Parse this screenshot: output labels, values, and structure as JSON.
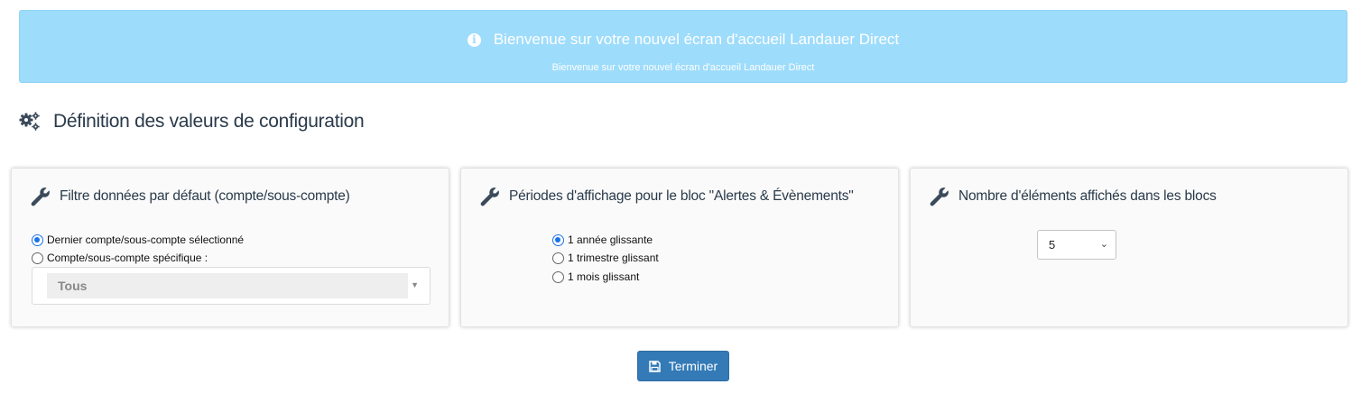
{
  "banner": {
    "title": "Bienvenue sur votre nouvel écran d'accueil Landauer Direct",
    "subtitle": "Bienvenue sur votre nouvel écran d'accueil Landauer Direct",
    "icon": "info-icon"
  },
  "section": {
    "title": "Définition des valeurs de configuration",
    "icon": "gears-icon"
  },
  "cards": {
    "filter": {
      "title": "Filtre données par défaut (compte/sous-compte)",
      "icon": "wrench-icon",
      "options": [
        {
          "label": "Dernier compte/sous-compte sélectionné",
          "checked": true
        },
        {
          "label": "Compte/sous-compte spécifique :",
          "checked": false
        }
      ],
      "select_value": "Tous"
    },
    "periods": {
      "title": "Périodes d'affichage pour le bloc \"Alertes & Évènements\"",
      "icon": "wrench-icon",
      "options": [
        {
          "label": "1 année glissante",
          "checked": true
        },
        {
          "label": "1 trimestre glissant",
          "checked": false
        },
        {
          "label": "1 mois glissant",
          "checked": false
        }
      ]
    },
    "count": {
      "title": "Nombre d'éléments affichés dans les blocs",
      "icon": "wrench-icon",
      "select_value": "5"
    }
  },
  "finish_button": {
    "label": "Terminer",
    "icon": "save-icon"
  },
  "colors": {
    "banner_bg": "#9edcfb",
    "primary": "#337ab7",
    "radio_accent": "#1a73e8"
  }
}
